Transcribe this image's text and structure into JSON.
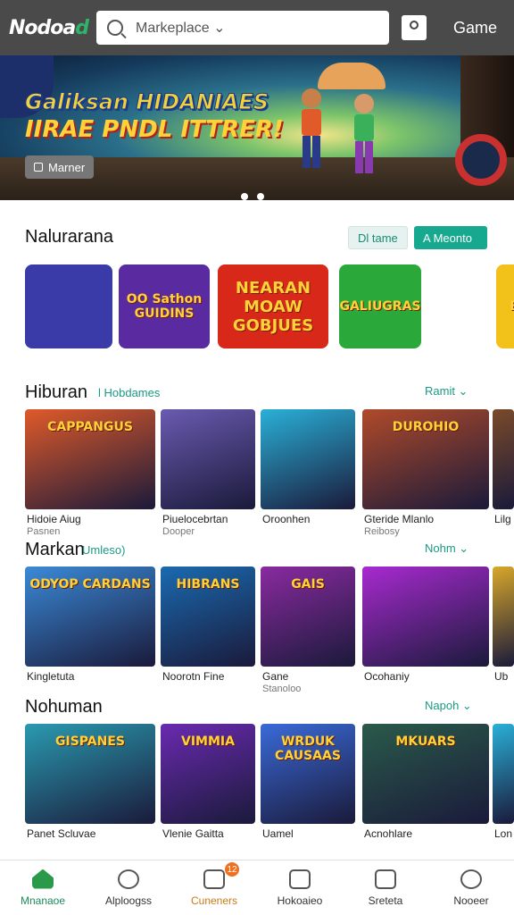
{
  "topbar": {
    "logo_main": "Nodoa",
    "logo_accent": "d",
    "search_placeholder": "Markeplace ⌄",
    "game_label": "Game"
  },
  "hero": {
    "title_line1": "Galiksan HIDANIAES",
    "title_line2": "IIRAE PNDL ITTRER!",
    "button_label": "Marner",
    "dots": 2
  },
  "featured": {
    "title": "Nalurarana",
    "pill_light": "Dl tame",
    "pill_dark": "A Meonto",
    "tiles": [
      {
        "label": "",
        "bg": "#3a3aa8"
      },
      {
        "label": "OO Sathon GUIDINS",
        "bg": "#5a2aa0"
      },
      {
        "label": "NEARAN MOAW GOBJUES",
        "bg": "#d8281a"
      },
      {
        "label": "GALIUGRAS",
        "bg": "#2aa83a"
      },
      {
        "label": "",
        "bg": "#ffffff"
      },
      {
        "label": "E",
        "bg": "#f2c21a"
      }
    ]
  },
  "sections": [
    {
      "title": "Hiburan",
      "subtitle": "l Hobdames",
      "link": "Ramit ⌄",
      "cards": [
        {
          "art": "CAPPANGUS",
          "title": "Hidoie Aiug",
          "sub": "Pasnen",
          "bg": "#e05a2a"
        },
        {
          "art": "",
          "title": "Piuelocebrtan",
          "sub": "Dooper",
          "bg": "#6a5ab0"
        },
        {
          "art": "",
          "title": "Oroonhen",
          "sub": "",
          "bg": "#2ab0d8"
        },
        {
          "art": "DUROHIO",
          "title": "Gteride Mlanlo",
          "sub": "Reibosy",
          "bg": "#b04a2a"
        },
        {
          "art": "",
          "title": "Lilg",
          "sub": "",
          "bg": "#7a4a2a"
        }
      ]
    },
    {
      "title": "Markan",
      "subtitle": "Umleso)",
      "link": "Nohm ⌄",
      "cards": [
        {
          "art": "ODYOP CARDANS",
          "title": "Kingletuta",
          "sub": "",
          "bg": "#3a8ad8"
        },
        {
          "art": "HIBRANS",
          "title": "Noorotn Fine",
          "sub": "",
          "bg": "#1a6ab0"
        },
        {
          "art": "GAIS",
          "title": "Gane",
          "sub": "Stanoloo",
          "bg": "#8a2aa0"
        },
        {
          "art": "",
          "title": "Ocohaniy",
          "sub": "",
          "bg": "#a82ad0"
        },
        {
          "art": "",
          "title": "Ub",
          "sub": "",
          "bg": "#d8a82a"
        }
      ]
    },
    {
      "title": "Nohuman",
      "subtitle": "",
      "link": "Napoh ⌄",
      "cards": [
        {
          "art": "GISPANES",
          "title": "Panet Scluvae",
          "sub": "",
          "bg": "#2a9ab0"
        },
        {
          "art": "VIMMIA",
          "title": "Vlenie Gaitta",
          "sub": "",
          "bg": "#6a2ab0"
        },
        {
          "art": "WRDUK CAUSAAS",
          "title": "Uamel",
          "sub": "",
          "bg": "#3a6ad8"
        },
        {
          "art": "MKUARS",
          "title": "Acnohlare",
          "sub": "",
          "bg": "#2a5a4a"
        },
        {
          "art": "",
          "title": "Lon",
          "sub": "",
          "bg": "#2ab0d8"
        }
      ]
    }
  ],
  "bottom_nav": [
    {
      "label": "Mnanaoe",
      "icon": "home-icon"
    },
    {
      "label": "Alploogss",
      "icon": "chat-icon"
    },
    {
      "label": "Cuneners",
      "icon": "cart-icon",
      "badge": "12"
    },
    {
      "label": "Hokoaieo",
      "icon": "shield-icon"
    },
    {
      "label": "Sreteta",
      "icon": "rocket-icon"
    },
    {
      "label": "Nooeer",
      "icon": "search-icon"
    }
  ]
}
